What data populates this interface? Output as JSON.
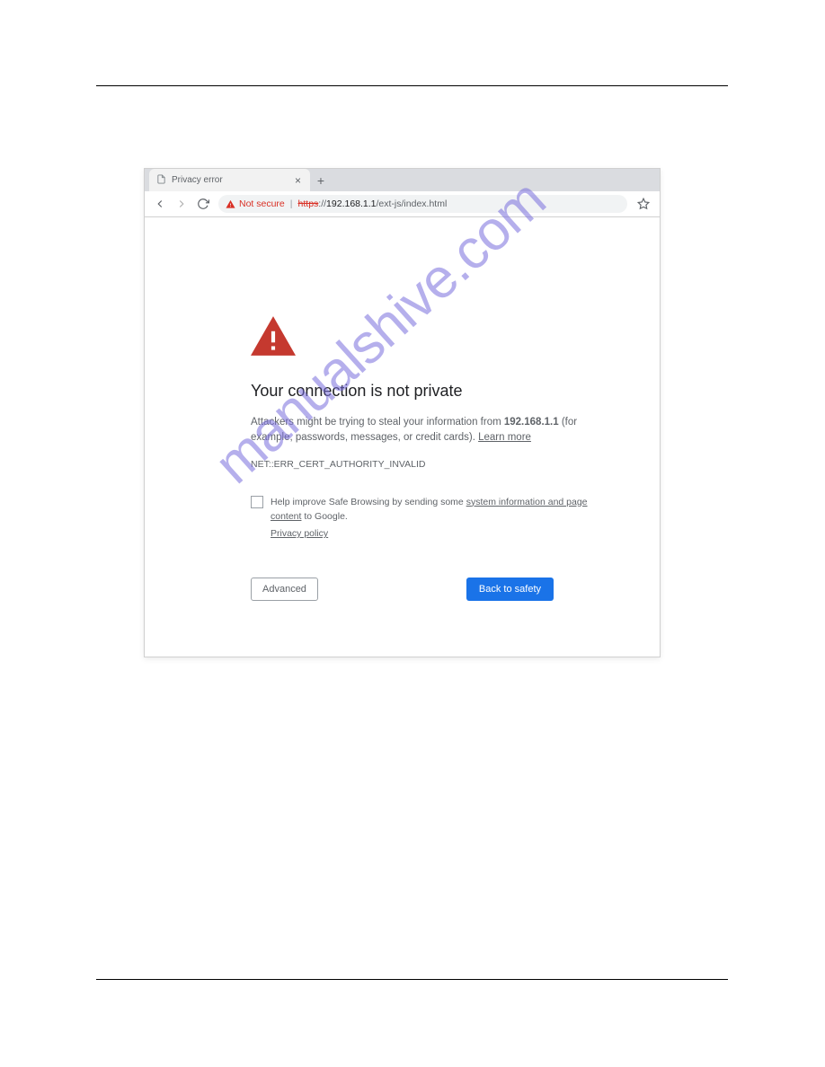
{
  "tab": {
    "title": "Privacy error",
    "close_label": "×",
    "new_tab_label": "+"
  },
  "address": {
    "not_secure_label": "Not secure",
    "separator": "|",
    "scheme_struck": "https",
    "scheme_tail": "://",
    "host_bold": "192.168.1.1",
    "path": "/ext-js/index.html"
  },
  "error_page": {
    "heading": "Your connection is not private",
    "body_prefix": "Attackers might be trying to steal your information from ",
    "body_host": "192.168.1.1",
    "body_suffix": " (for example, passwords, messages, or credit cards). ",
    "learn_more": "Learn more",
    "code": "NET::ERR_CERT_AUTHORITY_INVALID",
    "checkbox_prefix": "Help improve Safe Browsing by sending some ",
    "checkbox_link": "system information and page content",
    "checkbox_suffix": " to Google.",
    "privacy_policy": "Privacy policy",
    "advanced_btn": "Advanced",
    "back_btn": "Back to safety"
  },
  "watermark": "manualshive.com"
}
